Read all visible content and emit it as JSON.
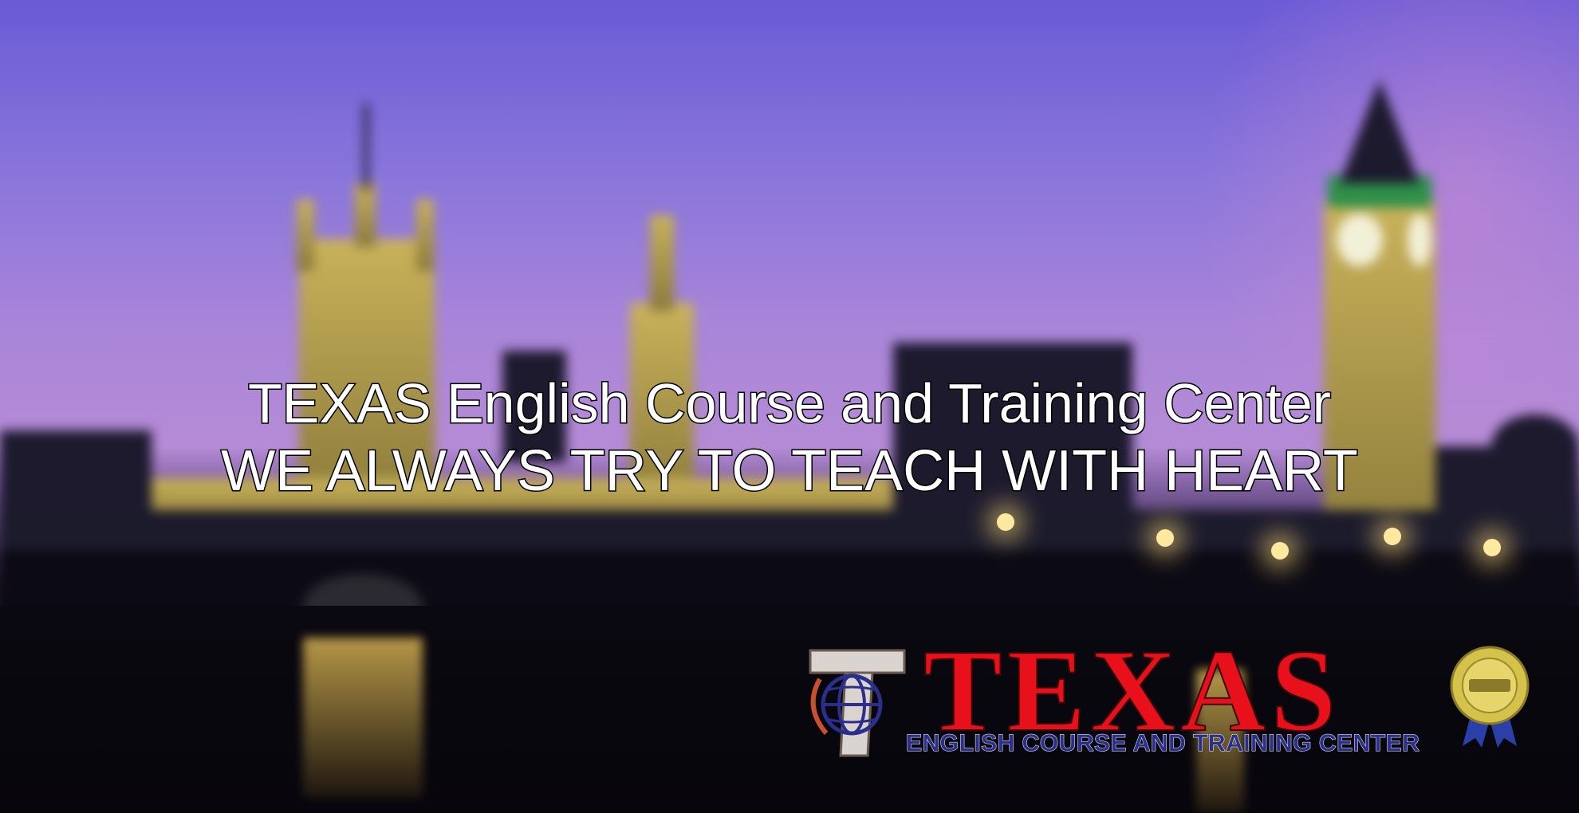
{
  "headline": {
    "line1": "TEXAS English Course and Training Center",
    "line2": "WE ALWAYS TRY TO TEACH WITH HEART"
  },
  "logo": {
    "word": "TEXAS",
    "subtitle": "ENGLISH COURSE AND TRAINING CENTER",
    "icon": "globe-t-icon",
    "seal_icon": "award-seal-icon",
    "colors": {
      "word": "#e8101a",
      "subtitle": "#2b2f8c",
      "seal": "#d4c24a"
    }
  }
}
